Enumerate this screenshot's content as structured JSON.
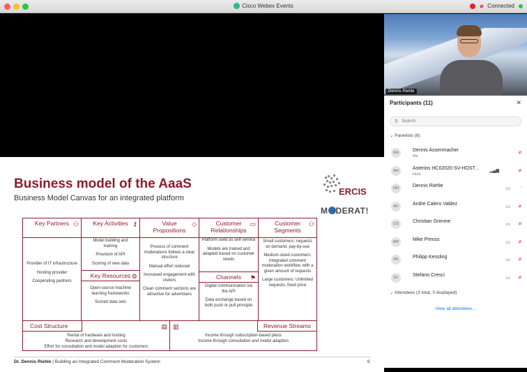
{
  "titlebar": {
    "app_title": "Cisco Webex Events",
    "status": "Connected"
  },
  "slide": {
    "title": "Business model of the AaaS",
    "subtitle": "Business Model Canvas for an integrated platform",
    "logo1": "ERCIS",
    "logo2_a": "M",
    "logo2_b": "DERAT!",
    "footer_name": "Dr. Dennis Riehle",
    "footer_text": " | Building an Integrated Comment Moderation System",
    "page": "6",
    "canvas": {
      "key_partners": {
        "title": "Key Partners",
        "items": [
          "Provider of IT infrastructure",
          "Hosting provider",
          "Cooperating partners"
        ]
      },
      "key_activities": {
        "title": "Key Activities",
        "items": [
          "Model building and training",
          "Provision of API",
          "Scoring of new data"
        ]
      },
      "key_resources": {
        "title": "Key Resources",
        "items": [
          "Open-source machine learning frameworks",
          "Scored data sets"
        ]
      },
      "value_propositions": {
        "title": "Value Propositions",
        "items": [
          "Process of comment moderations follows a clear structure",
          "Manual effort reduced",
          "Increased engagement with visitors",
          "Clean comment sections are attractive for advertisers"
        ]
      },
      "customer_relationships": {
        "title": "Customer Relationships",
        "items": [
          "Platform used as self-service",
          "Models are trained and adapted based on customer needs"
        ]
      },
      "channels": {
        "title": "Channels",
        "items": [
          "Digital communication via the API",
          "Data exchange based on both push or pull principle"
        ]
      },
      "customer_segments": {
        "title": "Customer Segments",
        "items": [
          "Small customers: requests on demand, pay-by-use",
          "Medium-sized customers: integrated comment moderation workflow, with a given amount of requests",
          "Large customers: Unlimited requests, fixed price"
        ]
      },
      "cost_structure": {
        "title": "Cost Structure",
        "items": [
          "Rental of hardware and hosting",
          "Research and development costs",
          "Effort for consultation and model adaption for customers"
        ]
      },
      "revenue_streams": {
        "title": "Revenue Streams",
        "items": [
          "Income through subscription-based plans",
          "Income through consultation and model adaption"
        ]
      }
    }
  },
  "camera": {
    "label": "Dennis Riehle"
  },
  "participants": {
    "title": "Participants (11)",
    "search_placeholder": "Search",
    "panelists_label": "Panelists (8)",
    "attendees_label": "Attendees (3 total, 0 displayed)",
    "view_all": "View all attendees...",
    "list": [
      {
        "initials": "DA",
        "name": "Dennis Assenmacher",
        "sub": "Me"
      },
      {
        "initials": "AH",
        "name": "Asterios HCII2020-SV-HOST...",
        "sub": "Host"
      },
      {
        "initials": "DR",
        "name": "Dennis Riehle",
        "sub": ""
      },
      {
        "initials": "AV",
        "name": "Andre Calero Valdez",
        "sub": ""
      },
      {
        "initials": "CG",
        "name": "Christian Grimme",
        "sub": ""
      },
      {
        "initials": "MP",
        "name": "Mike Preuss",
        "sub": ""
      },
      {
        "initials": "PK",
        "name": "Philipp Kessling",
        "sub": ""
      },
      {
        "initials": "SC",
        "name": "Stefano Cresci",
        "sub": ""
      }
    ]
  }
}
